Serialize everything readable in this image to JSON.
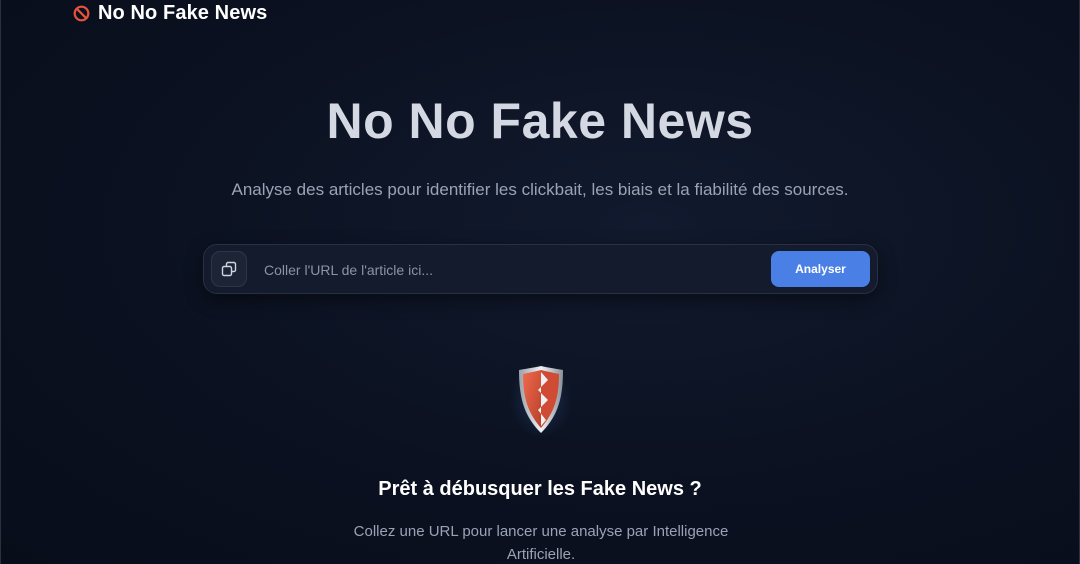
{
  "header": {
    "brand_icon": "prohibited-icon",
    "brand_name": "No No Fake News"
  },
  "hero": {
    "title": "No No Fake News",
    "subtitle": "Analyse des articles pour identifier les clickbait, les biais et la fiabilité des sources."
  },
  "search": {
    "paste_icon": "copy-paste-icon",
    "value": "",
    "placeholder": "Coller l'URL de l'article ici...",
    "button_label": "Analyser"
  },
  "empty_state": {
    "icon": "shield-icon",
    "title": "Prêt à débusquer les Fake News ?",
    "text": "Collez une URL pour lancer une analyse par Intelligence Artificielle."
  },
  "colors": {
    "background": "#0b1120",
    "accent": "#4a7fe6",
    "shield_red": "#e0583c"
  }
}
